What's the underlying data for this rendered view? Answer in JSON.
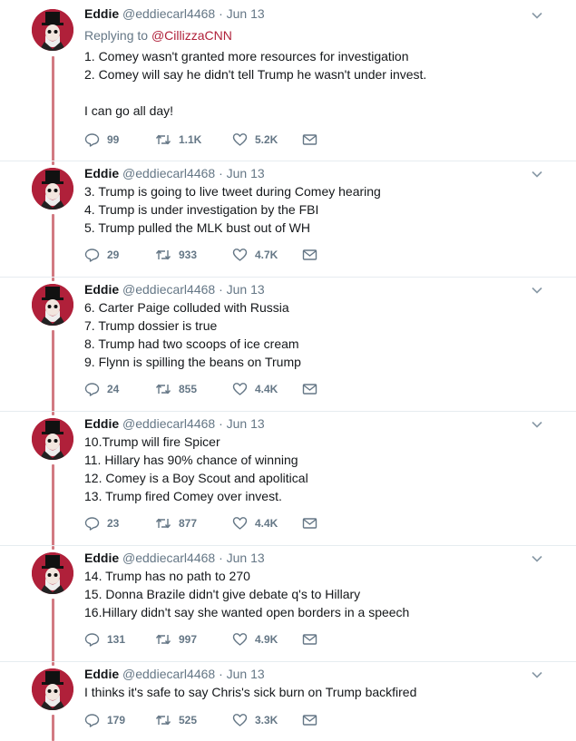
{
  "tweets": [
    {
      "author": {
        "name": "Eddie",
        "handle": "@eddiecarl4468"
      },
      "time": "Jun 13",
      "replying_prefix": "Replying to ",
      "replying_to": "@CillizzaCNN",
      "lines": [
        "1. Comey wasn't granted more resources for investigation",
        "2. Comey will say he didn't tell Trump he wasn't under invest.",
        "",
        "I can go all day!"
      ],
      "replies": "99",
      "retweets": "1.1K",
      "likes": "5.2K"
    },
    {
      "author": {
        "name": "Eddie",
        "handle": "@eddiecarl4468"
      },
      "time": "Jun 13",
      "lines": [
        "3. Trump is going to live tweet during Comey hearing",
        "4. Trump is under investigation by the FBI",
        "5. Trump pulled the MLK bust out of WH"
      ],
      "replies": "29",
      "retweets": "933",
      "likes": "4.7K"
    },
    {
      "author": {
        "name": "Eddie",
        "handle": "@eddiecarl4468"
      },
      "time": "Jun 13",
      "lines": [
        "6. Carter Paige colluded with Russia",
        "7. Trump dossier is true",
        "8. Trump had two scoops of ice cream",
        "9. Flynn is spilling the beans on Trump"
      ],
      "replies": "24",
      "retweets": "855",
      "likes": "4.4K"
    },
    {
      "author": {
        "name": "Eddie",
        "handle": "@eddiecarl4468"
      },
      "time": "Jun 13",
      "lines": [
        "10.Trump will fire Spicer",
        "11. Hillary has 90% chance of winning",
        "12. Comey is a Boy Scout and apolitical",
        "13. Trump fired Comey over invest."
      ],
      "replies": "23",
      "retweets": "877",
      "likes": "4.4K"
    },
    {
      "author": {
        "name": "Eddie",
        "handle": "@eddiecarl4468"
      },
      "time": "Jun 13",
      "lines": [
        "14. Trump has no path to 270",
        "15. Donna Brazile didn't give debate q's to Hillary",
        "16.Hillary didn't say she wanted open borders in a speech"
      ],
      "replies": "131",
      "retweets": "997",
      "likes": "4.9K"
    },
    {
      "author": {
        "name": "Eddie",
        "handle": "@eddiecarl4468"
      },
      "time": "Jun 13",
      "lines": [
        "I thinks it's safe to say Chris's sick burn on Trump backfired"
      ],
      "replies": "179",
      "retweets": "525",
      "likes": "3.3K"
    }
  ],
  "icons": {
    "reply": "reply-icon",
    "retweet": "retweet-icon",
    "like": "heart-icon",
    "dm": "envelope-icon",
    "caret": "chevron-down-icon",
    "avatar": "avatar-uncle-sam-hat"
  },
  "colors": {
    "name": "#14171a",
    "meta": "#657786",
    "mention": "#b0213a",
    "thread_line": "#d27a82",
    "avatar_bg": "#b0203a"
  }
}
